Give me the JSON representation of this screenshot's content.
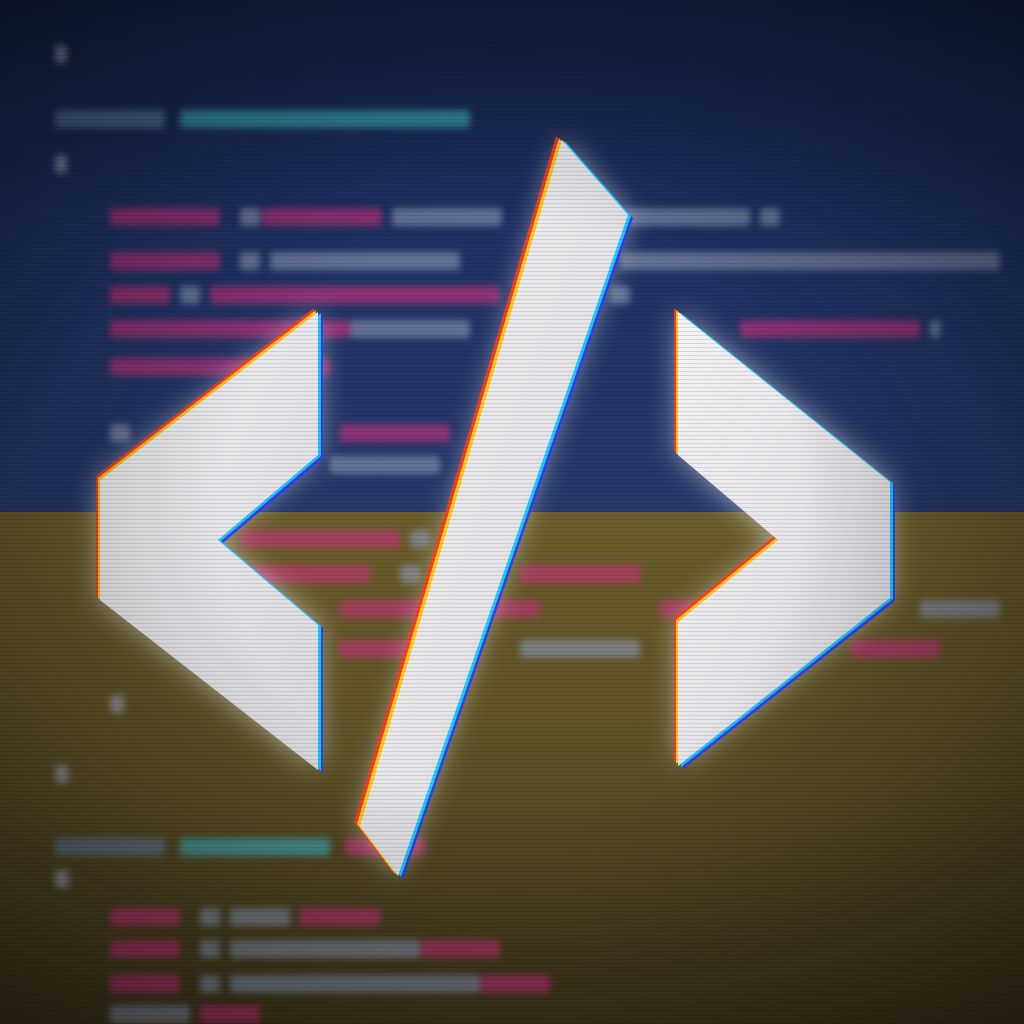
{
  "image": {
    "subject": "code-brackets-slash-icon",
    "background_colors": {
      "top": "#1f3264",
      "bottom": "#5a4e25"
    },
    "glyph_colors": {
      "fill": "#e9e9ec",
      "glow": "#ffffff",
      "red_fringe": "#ff3b1f",
      "yellow_fringe": "#ffe21a",
      "blue_fringe": "#2a3cff",
      "cyan_fringe": "#19e5ff"
    },
    "code_colors": {
      "keyword": "#5f7ea3",
      "function_name": "#3fb3c0",
      "variable": "#c5327a",
      "text": "#8a95b3",
      "brace": "#a2a8bf"
    }
  }
}
